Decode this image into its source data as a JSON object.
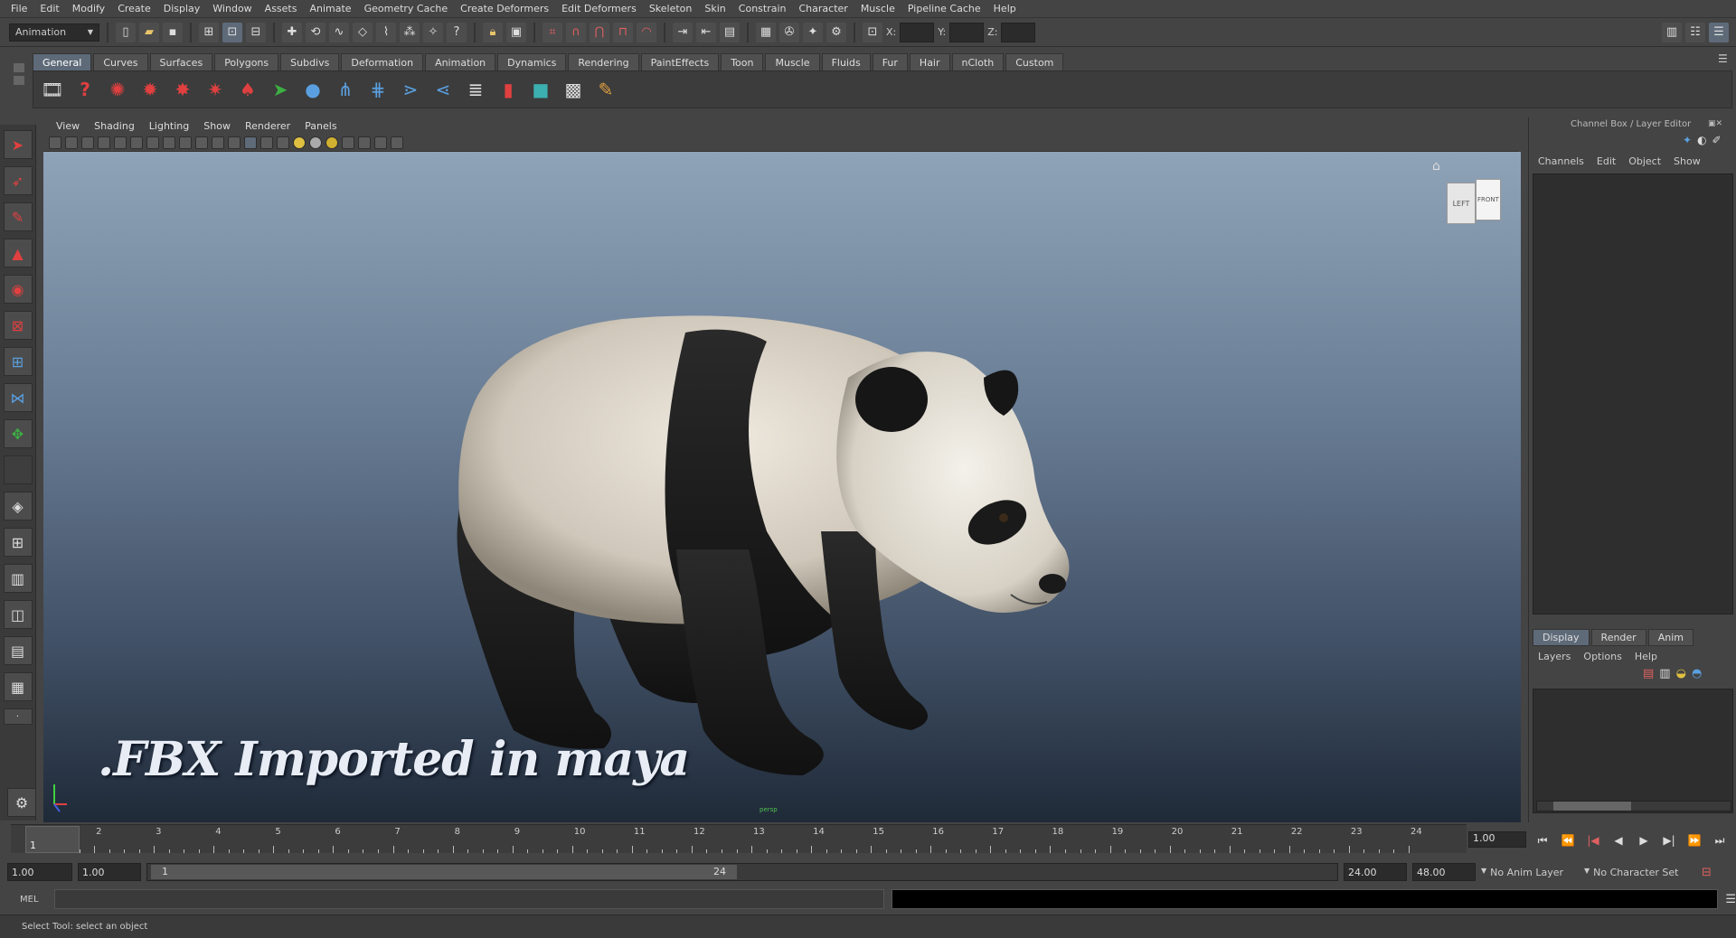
{
  "menubar": [
    "File",
    "Edit",
    "Modify",
    "Create",
    "Display",
    "Window",
    "Assets",
    "Animate",
    "Geometry Cache",
    "Create Deformers",
    "Edit Deformers",
    "Skeleton",
    "Skin",
    "Constrain",
    "Character",
    "Muscle",
    "Pipeline Cache",
    "Help"
  ],
  "statusline": {
    "menuset": "Animation",
    "x_label": "X:",
    "y_label": "Y:",
    "z_label": "Z:"
  },
  "shelf": {
    "tabs": [
      "General",
      "Curves",
      "Surfaces",
      "Polygons",
      "Subdivs",
      "Deformation",
      "Animation",
      "Dynamics",
      "Rendering",
      "PaintEffects",
      "Toon",
      "Muscle",
      "Fluids",
      "Fur",
      "Hair",
      "nCloth",
      "Custom"
    ],
    "active_tab": "General"
  },
  "panel": {
    "menus": [
      "View",
      "Shading",
      "Lighting",
      "Show",
      "Renderer",
      "Panels"
    ]
  },
  "viewport": {
    "caption": ".FBX Imported in maya",
    "viewcube_left": "LEFT",
    "viewcube_front": "FRONT",
    "camera_label": "persp"
  },
  "channelbox": {
    "title": "Channel Box / Layer Editor",
    "menus": [
      "Channels",
      "Edit",
      "Object",
      "Show"
    ]
  },
  "layereditor": {
    "tabs": [
      "Display",
      "Render",
      "Anim"
    ],
    "active_tab": "Display",
    "menus": [
      "Layers",
      "Options",
      "Help"
    ]
  },
  "timeline": {
    "ticks": [
      "1",
      "2",
      "3",
      "4",
      "5",
      "6",
      "7",
      "8",
      "9",
      "10",
      "11",
      "12",
      "13",
      "14",
      "15",
      "16",
      "17",
      "18",
      "19",
      "20",
      "21",
      "22",
      "23",
      "24"
    ],
    "current_frame": "1.00",
    "playhead": "1"
  },
  "rangebar": {
    "start": "1.00",
    "inner_start": "1.00",
    "slider_start": "1",
    "slider_end": "24",
    "end": "24.00",
    "outer_end": "48.00",
    "anim_layer": "No Anim Layer",
    "character_set": "No Character Set"
  },
  "cmdline": {
    "label": "MEL"
  },
  "helpline": {
    "text": "Select Tool: select an object"
  }
}
